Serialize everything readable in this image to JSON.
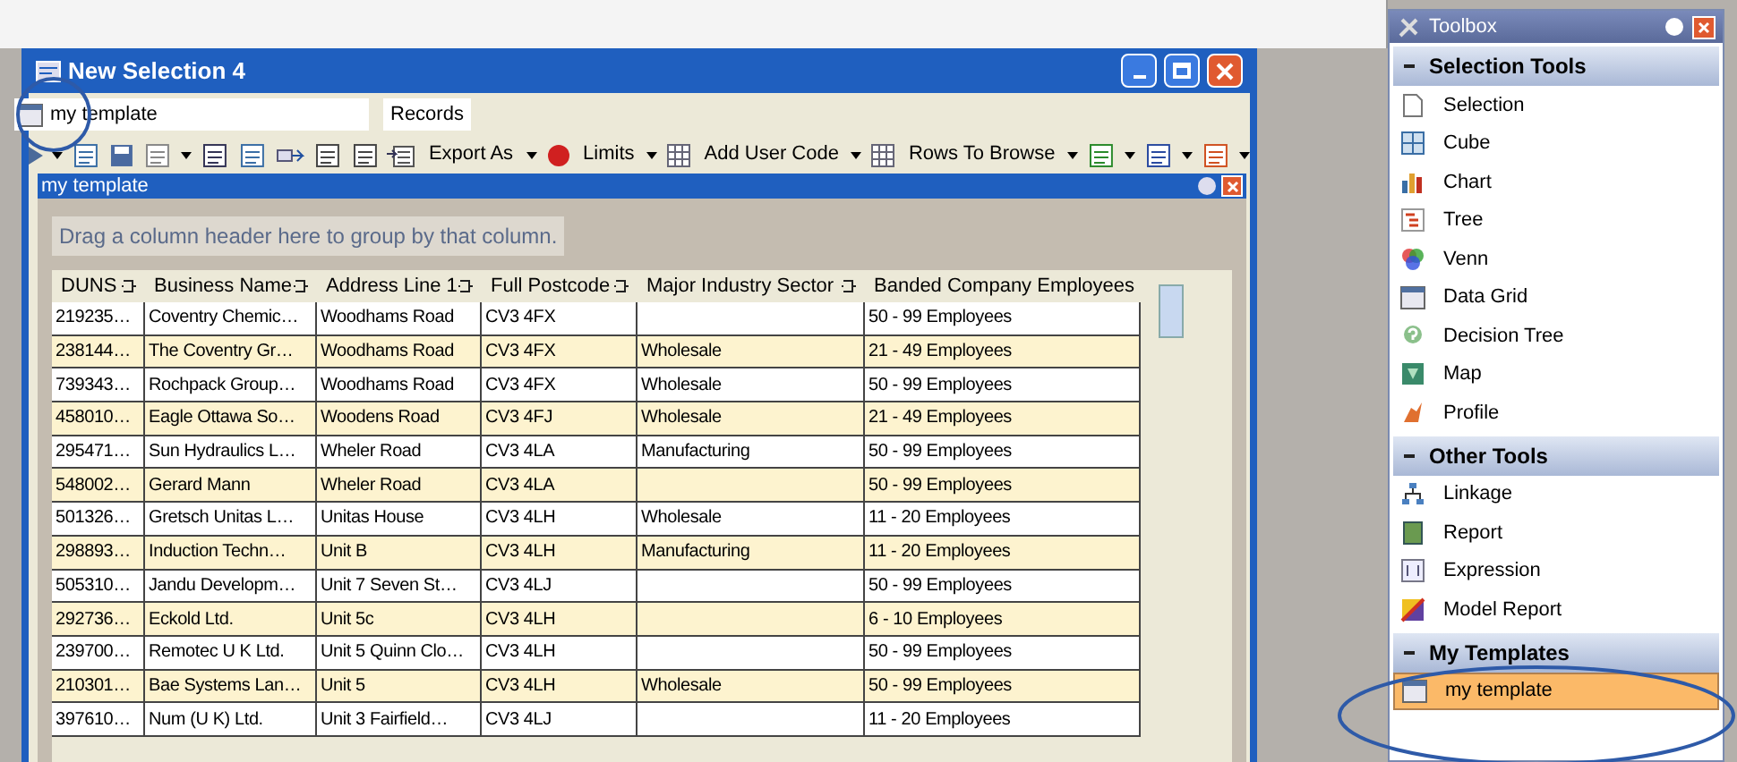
{
  "window": {
    "title": "New Selection 4"
  },
  "template_field": {
    "value": "my template"
  },
  "records_label": "Records",
  "toolbar_buttons": [
    {
      "label": "Export As",
      "kind": "export"
    },
    {
      "label": "Limits",
      "kind": "limits"
    },
    {
      "label": "Add User Code",
      "kind": "usercode"
    },
    {
      "label": "Rows To Browse",
      "kind": "rows"
    }
  ],
  "child_window": {
    "title": "my template"
  },
  "group_panel": {
    "text": "Drag a column header here to group by that column."
  },
  "table": {
    "columns": [
      "DUNS",
      "Business Name",
      "Address Line 1",
      "Full Postcode",
      "Major Industry Sector",
      "Banded Company Employees"
    ],
    "rows": [
      [
        "219235…",
        "Coventry Chemic…",
        "Woodhams Road",
        "CV3 4FX",
        "",
        "50 - 99 Employees"
      ],
      [
        "238144…",
        "The Coventry Gr…",
        "Woodhams Road",
        "CV3 4FX",
        "Wholesale",
        "21 - 49 Employees"
      ],
      [
        "739343…",
        "Rochpack Group…",
        "Woodhams Road",
        "CV3 4FX",
        "Wholesale",
        "50 - 99 Employees"
      ],
      [
        "458010…",
        "Eagle Ottawa So…",
        "Woodens Road",
        "CV3 4FJ",
        "Wholesale",
        "21 - 49 Employees"
      ],
      [
        "295471…",
        "Sun Hydraulics L…",
        "Wheler Road",
        "CV3 4LA",
        "Manufacturing",
        "50 - 99 Employees"
      ],
      [
        "548002…",
        "Gerard Mann",
        "Wheler Road",
        "CV3 4LA",
        "",
        "50 - 99 Employees"
      ],
      [
        "501326…",
        "Gretsch Unitas L…",
        "Unitas House",
        "CV3 4LH",
        "Wholesale",
        "11 - 20 Employees"
      ],
      [
        "298893…",
        "Induction Techn…",
        "Unit B",
        "CV3 4LH",
        "Manufacturing",
        "11 - 20 Employees"
      ],
      [
        "505310…",
        "Jandu Developm…",
        "Unit 7 Seven St…",
        "CV3 4LJ",
        "",
        "50 - 99 Employees"
      ],
      [
        "292736…",
        "Eckold Ltd.",
        "Unit 5c",
        "CV3 4LH",
        "",
        "6 - 10 Employees"
      ],
      [
        "239700…",
        "Remotec U K Ltd.",
        "Unit 5 Quinn Clo…",
        "CV3 4LH",
        "",
        "50 - 99 Employees"
      ],
      [
        "210301…",
        "Bae Systems Lan…",
        "Unit 5",
        "CV3 4LH",
        "Wholesale",
        "50 - 99 Employees"
      ],
      [
        "397610…",
        "Num (U K) Ltd.",
        "Unit 3 Fairfield…",
        "CV3 4LJ",
        "",
        "11 - 20 Employees"
      ]
    ]
  },
  "toolbox": {
    "title": "Toolbox",
    "sections": [
      {
        "title": "Selection Tools",
        "expanded": true,
        "items": [
          {
            "label": "Selection",
            "kind": "page",
            "selected": false
          },
          {
            "label": "Cube",
            "kind": "cube",
            "selected": false
          },
          {
            "label": "Chart",
            "kind": "chart",
            "selected": false
          },
          {
            "label": "Tree",
            "kind": "tree",
            "selected": false
          },
          {
            "label": "Venn",
            "kind": "venn",
            "selected": false
          },
          {
            "label": "Data Grid",
            "kind": "grid",
            "selected": false
          },
          {
            "label": "Decision Tree",
            "kind": "question",
            "selected": false
          },
          {
            "label": "Map",
            "kind": "map",
            "selected": false
          },
          {
            "label": "Profile",
            "kind": "profile",
            "selected": false
          }
        ]
      },
      {
        "title": "Other Tools",
        "expanded": true,
        "items": [
          {
            "label": "Linkage",
            "kind": "linkage",
            "selected": false
          },
          {
            "label": "Report",
            "kind": "report",
            "selected": false
          },
          {
            "label": "Expression",
            "kind": "expression",
            "selected": false
          },
          {
            "label": "Model Report",
            "kind": "model",
            "selected": false
          }
        ]
      },
      {
        "title": "My Templates",
        "expanded": true,
        "items": [
          {
            "label": "my template",
            "kind": "grid",
            "selected": true
          }
        ]
      }
    ]
  }
}
